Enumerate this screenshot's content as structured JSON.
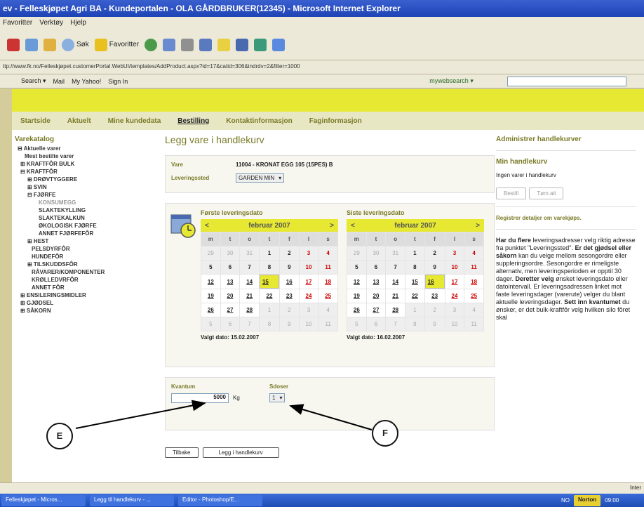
{
  "window": {
    "title": "ev - Felleskjøpet Agri BA - Kundeportalen - OLA GÅRDBRUKER(12345) - Microsoft Internet Explorer"
  },
  "menu": [
    "Favoritter",
    "Verktøy",
    "Hjelp"
  ],
  "toolbar": {
    "search_label": "Søk",
    "favorites_label": "Favoritter"
  },
  "address": {
    "url": "ttp://www.fk.no/Felleskjøpet.customerPortal.WebUI/templates/AddProduct.aspx?id=17&catid=306&indrdv=2&filter=1000"
  },
  "searchbar": {
    "search_label": "Search ▾",
    "mail_label": "Mail",
    "yahoo_label": "My Yahoo!",
    "signin_label": "Sign In",
    "websearch_label": "mywebsearch ▾"
  },
  "nav": [
    "Startside",
    "Aktuelt",
    "Mine kundedata",
    "Bestilling",
    "Kontaktinformasjon",
    "Faginformasjon"
  ],
  "sidebar": {
    "title": "Varekatalog",
    "items": [
      "⊟ Aktuelle varer",
      "Mest bestilte varer",
      "⊞ KRAFTFÔR BULK",
      "⊟ KRAFTFÔR",
      "⊞ DRØVTYGGERE",
      "⊞ SVIN",
      "⊟ FJØRFE",
      "KONSUMEGG",
      "SLAKTEKYLLING",
      "SLAKTEKALKUN",
      "ØKOLOGISK FJØRFE",
      "ANNET FJØRFEFÔR",
      "⊞ HEST",
      "PELSDYRFÔR",
      "HUNDEFÔR",
      "⊞ TILSKUDDSFÔR",
      "RÅVARER/KOMPONENTER",
      "KRØLLEDVRFÔR",
      "ANNET FÔR",
      "⊞ ENSILERINGSMIDLER",
      "⊞ GJØDSEL",
      "⊞ SÅKORN"
    ]
  },
  "main": {
    "title": "Legg vare i handlekurv",
    "vare_label": "Vare",
    "vare_value": "11004 - KRONAT EGG 105 (15PES) B",
    "sted_label": "Leveringssted",
    "sted_value": "GARDEN MIN"
  },
  "calendars": [
    {
      "label": "Første leveringsdato",
      "month": "februar 2007",
      "chosen": "Valgt dato: 15.02.2007"
    },
    {
      "label": "Siste leveringsdato",
      "month": "februar 2007",
      "chosen": "Valgt dato: 16.02.2007"
    }
  ],
  "weekdays": [
    "m",
    "t",
    "o",
    "t",
    "f",
    "l",
    "s"
  ],
  "weeks": [
    [
      "29",
      "30",
      "31",
      "1",
      "2",
      "3",
      "4"
    ],
    [
      "5",
      "6",
      "7",
      "8",
      "9",
      "10",
      "11"
    ],
    [
      "12",
      "13",
      "14",
      "15",
      "16",
      "17",
      "18"
    ],
    [
      "19",
      "20",
      "21",
      "22",
      "23",
      "24",
      "25"
    ],
    [
      "26",
      "27",
      "28",
      "1",
      "2",
      "3",
      "4"
    ],
    [
      "5",
      "6",
      "7",
      "8",
      "9",
      "10",
      "11"
    ]
  ],
  "qty": {
    "kvantum_label": "Kvantum",
    "kvantum_value": "5000",
    "unit": "Kg",
    "sdoser_label": "Sdoser",
    "sdoser_value": "1"
  },
  "buttons": {
    "back": "Tilbake",
    "add": "Legg i handlekurv"
  },
  "right": {
    "administer": "Administrer handlekurver",
    "cart_title": "Min handlekurv",
    "cart_empty": "Ingen varer i handlekurv",
    "btn_order": "Bestill",
    "btn_clear": "Tøm alt",
    "register": "Registrer detaljer om varekjøps.",
    "p1_head": "Har du flere",
    "p1_text": "leveringsadresser velg riktig adresse fra punktet \"Leveringssted\".",
    "p2_head": "Er det gjødsel eller såkorn",
    "p2_text": "kan du velge mellom sesongordre eller suppleringsordre. Sesongordre er rimeligste alternativ, men leveringsperioden er opptil 30 dager.",
    "p3_head": "Deretter velg",
    "p3_text": "ønsket leveringsdato eller datointervall. Er leveringsadressen linket mot faste leveringsdager (varerute) velger du blant aktuelle leveringsdager.",
    "p4_head": "Sett inn kvantumet",
    "p4_text": "du ønsker, er det bulk-kraftfôr velg hvilken silo fôret skal"
  },
  "callouts": {
    "e": "E",
    "f": "F"
  },
  "status": {
    "zone": "Inter"
  },
  "taskbar": [
    "Felleskjøpet - Micros...",
    "Legg til handlekurv - ...",
    "Editor - Photoshop/E...",
    "NO",
    "Norton",
    "09:00"
  ]
}
